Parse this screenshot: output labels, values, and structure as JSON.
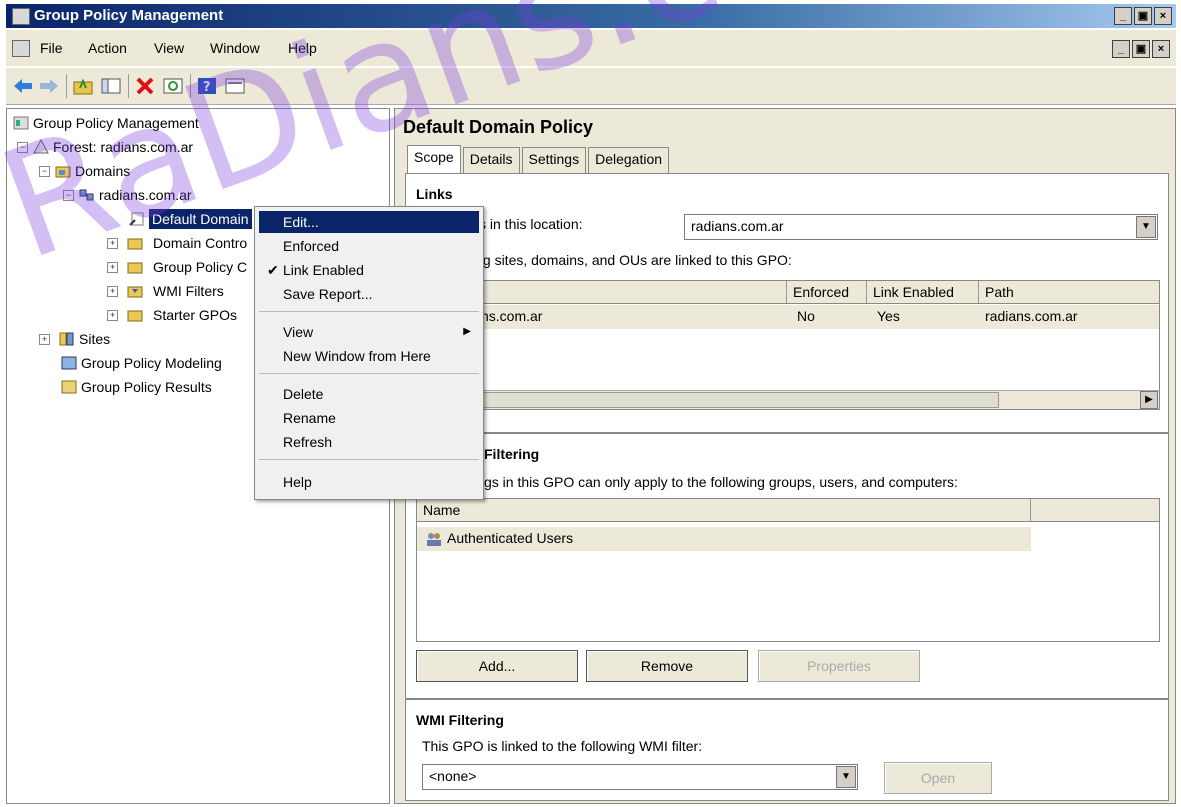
{
  "window": {
    "title": "Group Policy Management",
    "controls": [
      "_",
      "▣",
      "×"
    ]
  },
  "menu": {
    "items": [
      "File",
      "Action",
      "View",
      "Window",
      "Help"
    ]
  },
  "tree": {
    "root": "Group Policy Management",
    "forest": "Forest: radians.com.ar",
    "domains": "Domains",
    "domain": "radians.com.ar",
    "selected": "Default Domain",
    "items": [
      "Domain Contro",
      "Group Policy C",
      "WMI Filters",
      "Starter GPOs"
    ],
    "sites": "Sites",
    "modeling": "Group Policy Modeling",
    "results": "Group Policy Results"
  },
  "context_menu": {
    "items": [
      "Edit...",
      "Enforced",
      "Link Enabled",
      "Save Report...",
      "View",
      "New Window from Here",
      "Delete",
      "Rename",
      "Refresh",
      "Help"
    ],
    "checked": "Link Enabled",
    "highlighted": "Edit..."
  },
  "detail": {
    "title": "Default Domain Policy",
    "tabs": [
      "Scope",
      "Details",
      "Settings",
      "Delegation"
    ],
    "active_tab": "Scope",
    "links": {
      "heading": "Links",
      "display_label": "ks in this location:",
      "location_value": "radians.com.ar",
      "linked_text": "ing sites, domains, and OUs are linked to this GPO:",
      "columns": [
        "Enforced",
        "Link Enabled",
        "Path"
      ],
      "rows": [
        {
          "location": "ns.com.ar",
          "enforced": "No",
          "link_enabled": "Yes",
          "path": "radians.com.ar"
        }
      ]
    },
    "security": {
      "heading": "Filtering",
      "desc": "gs in this GPO can only apply to the following groups, users, and computers:",
      "column": "Name",
      "entries": [
        "Authenticated Users"
      ],
      "buttons": [
        "Add...",
        "Remove",
        "Properties"
      ]
    },
    "wmi": {
      "heading": "WMI Filtering",
      "desc": "This GPO is linked to the following WMI filter:",
      "value": "<none>",
      "open_label": "Open"
    }
  },
  "watermark": "RaDians.com.ar"
}
